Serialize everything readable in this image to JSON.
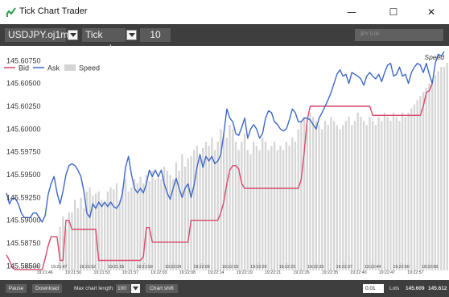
{
  "window": {
    "title": "Tick Chart Trader",
    "controls": {
      "minimize": "—",
      "maximize": "☐",
      "close": "✕"
    }
  },
  "toolbar": {
    "symbol": "USDJPY.oj1m",
    "mode": "Tick speed",
    "value": "10",
    "quote_field": "JPY 0.00"
  },
  "colors": {
    "bid": "#d8496c",
    "ask": "#3d68c8",
    "speed": "#d5d5d5",
    "toolbar": "#3e3e3e"
  },
  "chart_data": {
    "type": "line",
    "title": "",
    "speed_label": "Speed",
    "legend": {
      "placement": "top-left",
      "entries": [
        "Bid",
        "Ask",
        "Speed"
      ]
    },
    "y_ticks": [
      "145.60750",
      "145.60500",
      "145.60250",
      "145.60000",
      "145.59750",
      "145.59500",
      "145.59250",
      "145.59000",
      "145.58750",
      "145.58500"
    ],
    "ylim": [
      145.5845,
      145.6085
    ],
    "x_ticks": [
      "19:21:43",
      "19:21:46",
      "19:21:47",
      "19:21:50",
      "19:21:52",
      "19:21:53",
      "19:21:55",
      "19:21:57",
      "19:21:59",
      "19:22:03",
      "19:22:04",
      "19:22:08",
      "19:22:09",
      "19:22:14",
      "19:22:18",
      "19:22:19",
      "19:22:20",
      "19:22:21",
      "19:22:23",
      "19:22:26",
      "19:22:33",
      "19:22:35",
      "19:22:37",
      "19:22:40",
      "19:22:44",
      "19:22:47",
      "19:22:50",
      "19:22:57",
      "19:22:58"
    ],
    "series": [
      {
        "name": "Bid",
        "values": [
          145.5862,
          145.5856,
          145.5848,
          145.5846,
          145.5846,
          145.5846,
          145.5846,
          145.5846,
          145.5846,
          145.5846,
          145.5846,
          145.5846,
          145.5846,
          145.5858,
          145.5872,
          145.5882,
          145.5882,
          145.5882,
          145.5856,
          145.5856,
          145.59,
          145.59,
          145.589,
          145.589,
          145.589,
          145.589,
          145.589,
          145.589,
          145.589,
          145.589,
          145.589,
          145.5856,
          145.5856,
          145.5856,
          145.5856,
          145.5856,
          145.5856,
          145.5856,
          145.5856,
          145.5856,
          145.5856,
          145.5856,
          145.5856,
          145.5856,
          145.5856,
          145.5856,
          145.586,
          145.5892,
          145.5892,
          145.5876,
          145.5876,
          145.5876,
          145.5876,
          145.5876,
          145.5876,
          145.5876,
          145.5876,
          145.5876,
          145.5876,
          145.5876,
          145.5876,
          145.5876,
          145.59,
          145.59,
          145.59,
          145.59,
          145.59,
          145.59,
          145.59,
          145.59,
          145.59,
          145.59,
          145.5908,
          145.592,
          145.594,
          145.5955,
          145.596,
          145.596,
          145.5956,
          145.594,
          145.5935,
          145.5935,
          145.5935,
          145.5935,
          145.5935,
          145.5935,
          145.5935,
          145.5935,
          145.5935,
          145.5935,
          145.5935,
          145.5935,
          145.5935,
          145.5935,
          145.5935,
          145.5935,
          145.5935,
          145.5935,
          145.5935,
          145.5945,
          145.5975,
          145.601,
          145.6025,
          145.6025,
          145.6025,
          145.6025,
          145.6025,
          145.6025,
          145.6025,
          145.6025,
          145.6025,
          145.6025,
          145.6025,
          145.6025,
          145.6025,
          145.6025,
          145.6025,
          145.6025,
          145.6025,
          145.6025,
          145.6025,
          145.6025,
          145.6025,
          145.6015,
          145.6015,
          145.6015,
          145.6015,
          145.6015,
          145.6015,
          145.6015,
          145.6015,
          145.6015,
          145.6015,
          145.6015,
          145.6015,
          145.6015,
          145.6015,
          145.6015,
          145.6015,
          145.6015,
          145.6025,
          145.604,
          145.6042,
          145.605
        ]
      },
      {
        "name": "Ask",
        "values": [
          145.593,
          145.5918,
          145.5924,
          145.5924,
          145.5918,
          145.5908,
          145.5903,
          145.5903,
          145.5903,
          145.5908,
          145.5908,
          145.5903,
          145.5898,
          145.5905,
          145.5928,
          145.594,
          145.5948,
          145.593,
          145.5918,
          145.5932,
          145.595,
          145.596,
          145.5962,
          145.596,
          145.5955,
          145.5948,
          145.5932,
          145.5908,
          145.5903,
          145.5918,
          145.5913,
          145.592,
          145.5915,
          145.592,
          145.5915,
          145.592,
          145.5915,
          145.5913,
          145.5918,
          145.593,
          145.5958,
          145.597,
          145.595,
          145.5935,
          145.593,
          145.5935,
          145.593,
          145.594,
          145.5955,
          145.5948,
          145.5955,
          145.5948,
          145.5955,
          145.594,
          145.593,
          145.5923,
          145.5935,
          145.5946,
          145.5935,
          145.5925,
          145.5935,
          145.594,
          145.5925,
          145.5938,
          145.5958,
          145.5972,
          145.5958,
          145.597,
          145.5965,
          145.597,
          145.5962,
          145.5965,
          145.5972,
          145.5995,
          145.6022,
          145.6012,
          145.6008,
          145.5995,
          145.5993,
          145.6002,
          145.6012,
          145.599,
          145.6,
          145.6005,
          145.6,
          145.599,
          145.5995,
          145.6012,
          145.602,
          145.6018,
          145.6008,
          145.6005,
          145.6,
          145.5998,
          145.6,
          145.601,
          145.6022,
          145.6018,
          145.6008,
          145.6008,
          145.6012,
          145.6012,
          145.601,
          145.6005,
          145.6,
          145.6012,
          145.6018,
          145.6025,
          145.6032,
          145.604,
          145.605,
          145.606,
          145.6065,
          145.6058,
          145.606,
          145.605,
          145.6062,
          145.606,
          145.6058,
          145.6055,
          145.6048,
          145.6058,
          145.6062,
          145.6058,
          145.6055,
          145.606,
          145.6052,
          145.6062,
          145.607,
          145.6072,
          145.6058,
          145.606,
          145.6068,
          145.6058,
          145.606,
          145.605,
          145.6062,
          145.6068,
          145.6072,
          145.607,
          145.6062,
          145.6072,
          145.606,
          145.605,
          145.6072,
          145.6082,
          145.608,
          145.6085
        ]
      },
      {
        "name": "Speed",
        "values": [
          0,
          0,
          0,
          0,
          0,
          0,
          0,
          0,
          0,
          0,
          0,
          0,
          0,
          0,
          0,
          0,
          0,
          0,
          21,
          26,
          20,
          28,
          28,
          34,
          30,
          35,
          30,
          38,
          40,
          36,
          37,
          38,
          34,
          32,
          38,
          40,
          39,
          42,
          34,
          40,
          44,
          38,
          40,
          44,
          42,
          45,
          42,
          46,
          43,
          48,
          44,
          46,
          44,
          50,
          48,
          46,
          44,
          52,
          48,
          56,
          50,
          54,
          55,
          58,
          60,
          56,
          59,
          62,
          60,
          64,
          58,
          62,
          68,
          66,
          64,
          70,
          68,
          62,
          58,
          62,
          66,
          58,
          56,
          62,
          60,
          58,
          64,
          62,
          58,
          60,
          62,
          58,
          60,
          58,
          62,
          60,
          64,
          62,
          68,
          72,
          74,
          70,
          76,
          74,
          72,
          70,
          68,
          72,
          70,
          74,
          72,
          70,
          68,
          70,
          72,
          74,
          70,
          72,
          76,
          74,
          72,
          70,
          74,
          72,
          70,
          74,
          72,
          76,
          74,
          72,
          76,
          74,
          72,
          76,
          74,
          76,
          78,
          80,
          82,
          84,
          86,
          88,
          90,
          92,
          94,
          96,
          98,
          98,
          100
        ]
      }
    ]
  },
  "bottom": {
    "pause": "Pause",
    "download": "Download",
    "max_length_label": "Max chart length:",
    "max_length_value": "100",
    "chart_shift": "Chart shift",
    "lots_value": "0.01",
    "lots_label": "Lots",
    "bid": "145.609",
    "ask": "145.612"
  }
}
